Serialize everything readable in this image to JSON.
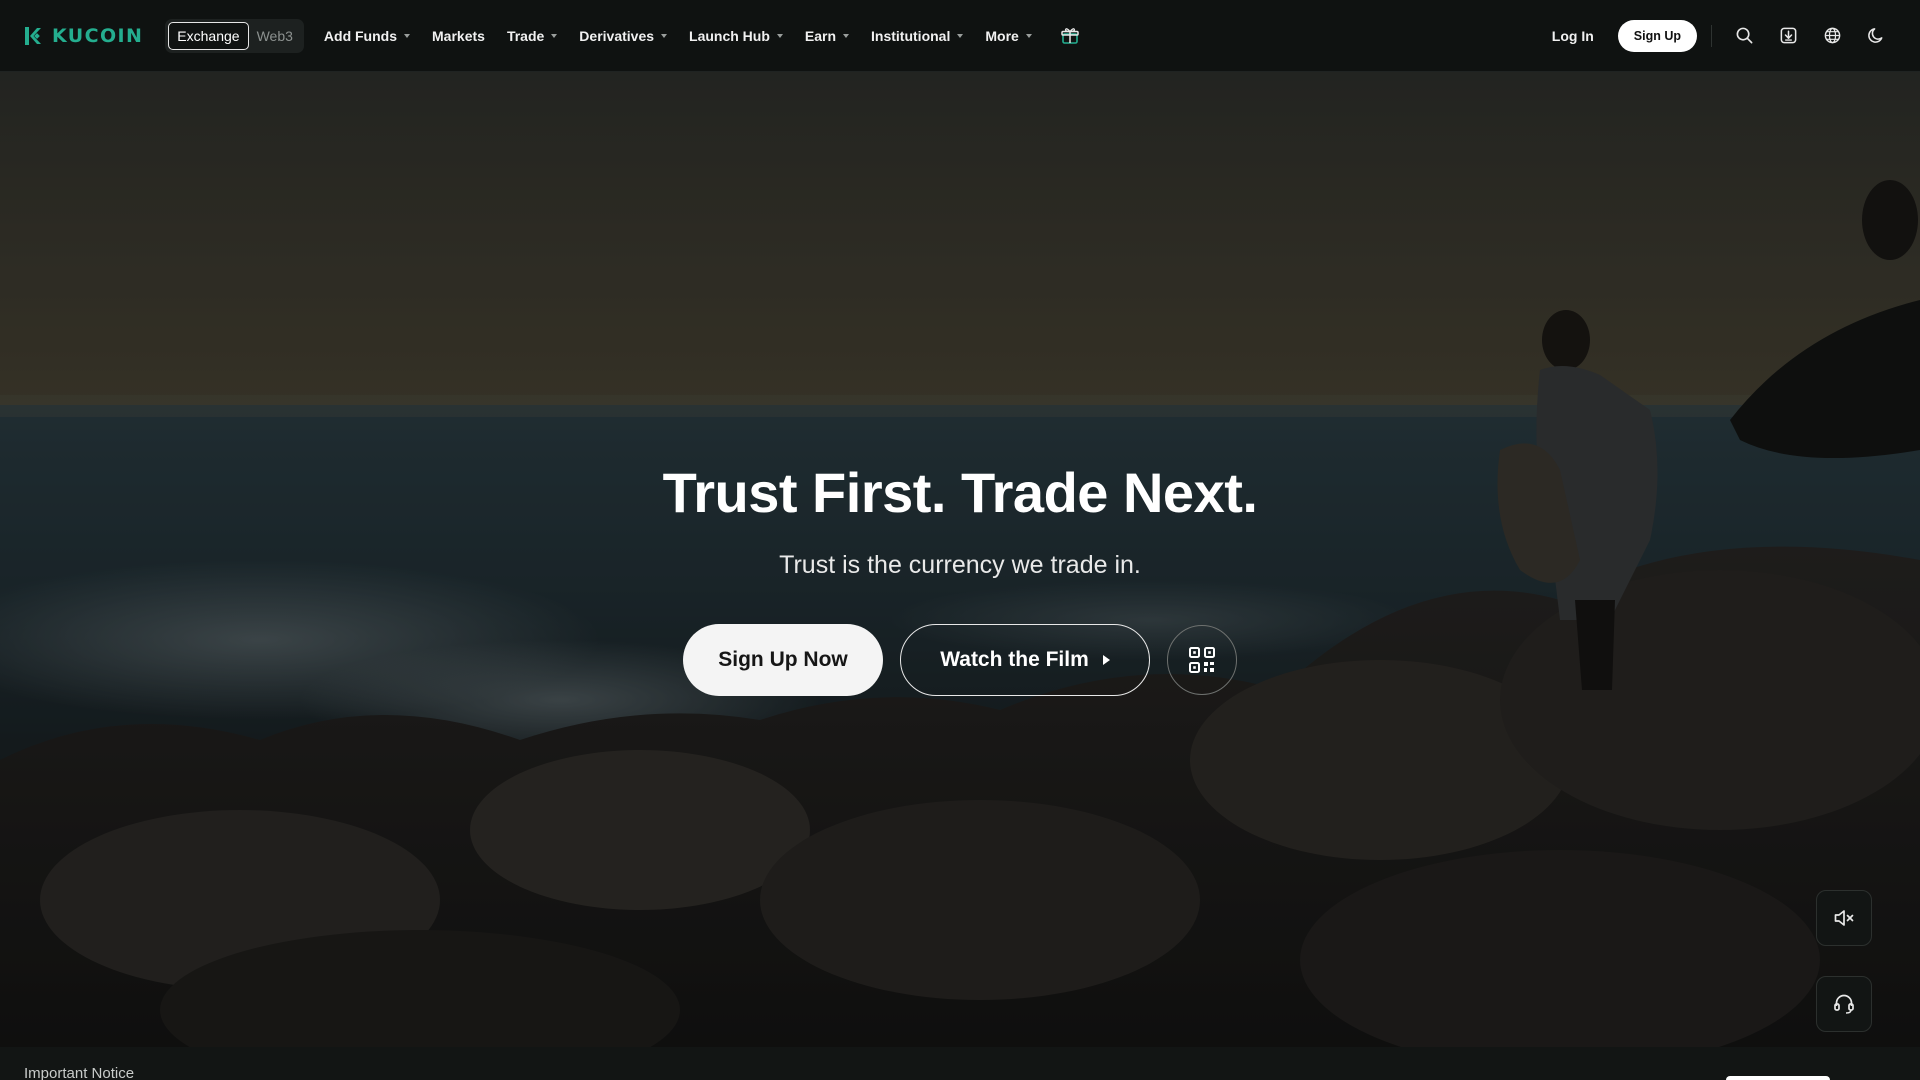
{
  "brand": {
    "name": "KUCOIN",
    "accent": "#24AE8F"
  },
  "mode_switch": {
    "exchange": "Exchange",
    "web3": "Web3",
    "active": "Exchange"
  },
  "nav": {
    "add_funds": "Add Funds",
    "markets": "Markets",
    "trade": "Trade",
    "derivatives": "Derivatives",
    "launch_hub": "Launch Hub",
    "earn": "Earn",
    "institutional": "Institutional",
    "more": "More",
    "gift_icon": "gift-icon"
  },
  "header_actions": {
    "login": "Log In",
    "signup": "Sign Up",
    "icons": [
      "search-icon",
      "download-icon",
      "globe-icon",
      "moon-icon"
    ]
  },
  "hero": {
    "title": "Trust First. Trade Next.",
    "subtitle": "Trust is the currency we trade in.",
    "primary_cta": "Sign Up Now",
    "secondary_cta": "Watch the Film",
    "qr_icon": "qr-code-icon"
  },
  "floating": {
    "mute_icon": "speaker-muted-icon",
    "support_icon": "headset-icon"
  },
  "notice": {
    "label": "Important Notice"
  }
}
